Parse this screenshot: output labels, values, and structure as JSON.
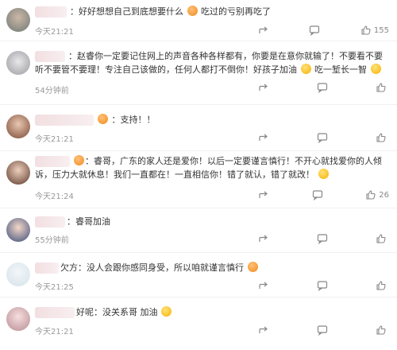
{
  "comments": [
    {
      "suffix": "：",
      "text": "好好想想自己到底想要什么",
      "text_after": "吃过的亏别再吃了",
      "time": "今天21:21",
      "likes": "155"
    },
    {
      "suffix": "：",
      "text": "赵睿你一定要记住网上的声音各种各样都有，你要是在意你就输了！不要看不要听不要管不要理！专注自己该做的，任何人都打不倒你！好孩子加油",
      "text_after": "吃一堑长一智",
      "time": "54分钟前",
      "likes": ""
    },
    {
      "suffix": "：",
      "text": "支持！！",
      "text_after": "",
      "time": "今天21:21",
      "likes": ""
    },
    {
      "suffix": "：",
      "text": "睿哥，广东的家人还是爱你！以后一定要谨言慎行！不开心就找爱你的人倾诉，压力大就休息！我们一直都在！一直相信你！错了就认，错了就改！",
      "text_after": "",
      "time": "今天21:24",
      "likes": "26"
    },
    {
      "suffix": "：",
      "text": "睿哥加油",
      "text_after": "",
      "time": "55分钟前",
      "likes": ""
    },
    {
      "suffix": "欠方：",
      "text": "没人会跟你感同身受，所以咱就谨言慎行",
      "text_after": "",
      "time": "今天21:25",
      "likes": ""
    },
    {
      "suffix": "好呢：",
      "text": "没关系哥 加油",
      "text_after": "",
      "time": "今天21:21",
      "likes": ""
    }
  ],
  "icons": {
    "share": "share-icon",
    "comment": "comment-icon",
    "like": "thumbs-up-icon"
  },
  "colors": {
    "time": "#999999",
    "name_blur": "#f2dfe1",
    "emoji": "#f5b100"
  }
}
